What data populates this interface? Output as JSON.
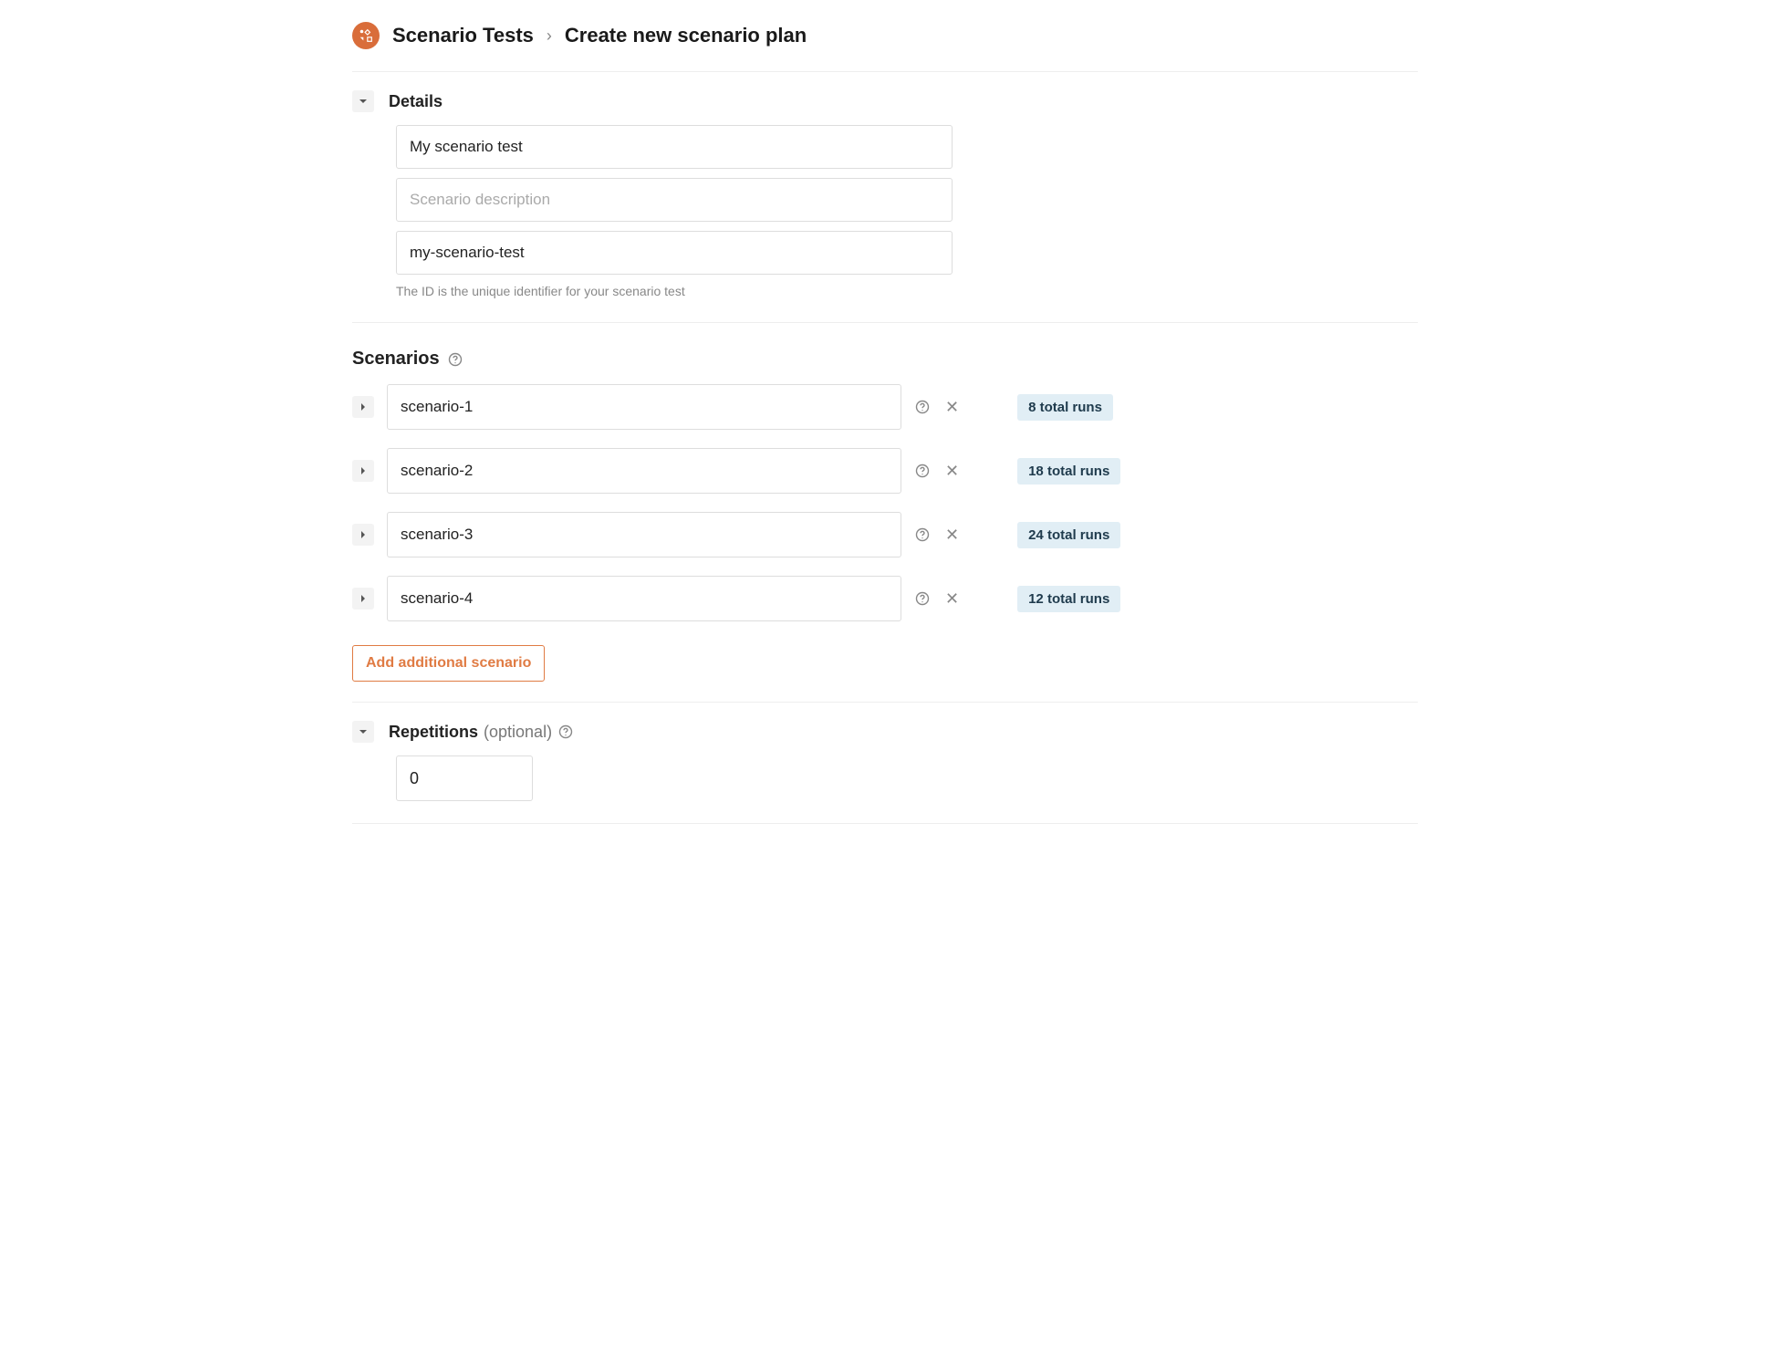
{
  "breadcrumb": {
    "root": "Scenario Tests",
    "current": "Create new scenario plan"
  },
  "details": {
    "heading": "Details",
    "name_value": "My scenario test",
    "description_value": "",
    "description_placeholder": "Scenario description",
    "id_value": "my-scenario-test",
    "id_hint": "The ID is the unique identifier for your scenario test"
  },
  "scenarios": {
    "heading": "Scenarios",
    "items": [
      {
        "name": "scenario-1",
        "runs_label": "8 total runs"
      },
      {
        "name": "scenario-2",
        "runs_label": "18 total runs"
      },
      {
        "name": "scenario-3",
        "runs_label": "24 total runs"
      },
      {
        "name": "scenario-4",
        "runs_label": "12 total runs"
      }
    ],
    "add_label": "Add additional scenario"
  },
  "repetitions": {
    "heading": "Repetitions",
    "optional_label": "(optional)",
    "value": "0"
  }
}
